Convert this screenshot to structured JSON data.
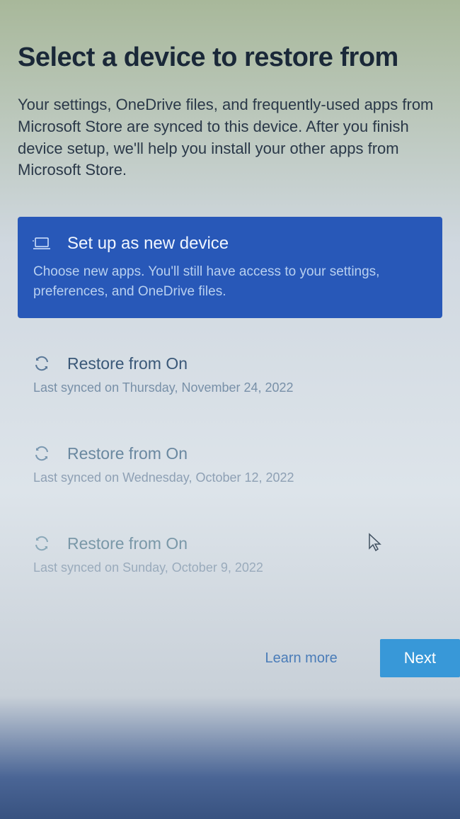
{
  "header": {
    "title": "Select a device to restore from",
    "description": "Your settings, OneDrive files, and frequently-used apps from Microsoft Store are synced to this device. After you finish device setup, we'll help you install your other apps from Microsoft Store."
  },
  "options": {
    "new_device": {
      "title": "Set up as new device",
      "subtitle": "Choose new apps. You'll still have access to your settings, preferences, and OneDrive files."
    },
    "restore_items": [
      {
        "title": "Restore from On",
        "subtitle": "Last synced on Thursday, November 24, 2022"
      },
      {
        "title": "Restore from On",
        "subtitle": "Last synced on Wednesday, October 12, 2022"
      },
      {
        "title": "Restore from On",
        "subtitle": "Last synced on Sunday, October 9, 2022"
      }
    ]
  },
  "footer": {
    "learn_more": "Learn more",
    "next": "Next"
  }
}
